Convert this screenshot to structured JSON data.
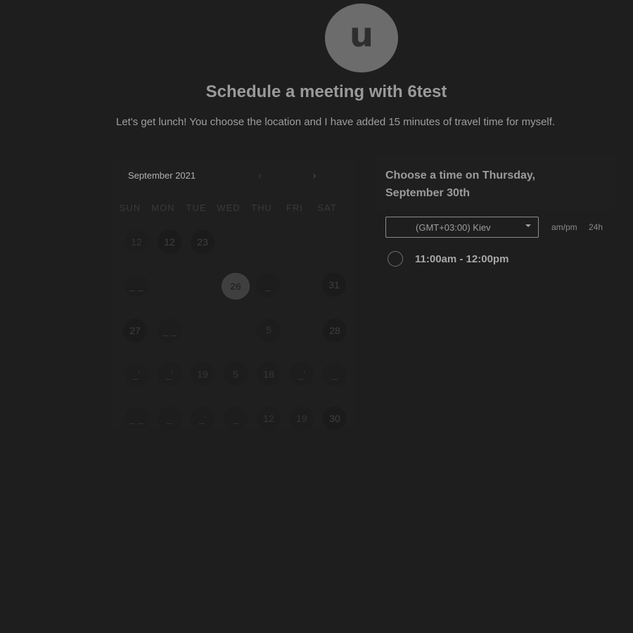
{
  "host": {
    "avatar_initial": "u",
    "title": "Schedule a meeting with 6test",
    "description": "Let's get lunch! You choose the location and I have added 15 minutes of travel time for myself."
  },
  "calendar": {
    "month_label": "September 2021",
    "prev_icon": "‹",
    "next_icon": "›",
    "weekdays": [
      "SUN",
      "MON",
      "TUE",
      "WED",
      "THU",
      "FRI",
      "SAT"
    ],
    "days": [
      {
        "label": "12",
        "state": "faded"
      },
      {
        "label": "12",
        "state": "available"
      },
      {
        "label": "23",
        "state": "available"
      },
      {
        "label": "_ _",
        "state": "faded"
      },
      {
        "label": "26",
        "state": "selected"
      },
      {
        "label": "_",
        "state": "faded"
      },
      {
        "label": "31",
        "state": "available"
      },
      {
        "label": "27",
        "state": "available"
      },
      {
        "label": "_ _",
        "state": "faded"
      },
      {
        "label": "5",
        "state": "faded"
      },
      {
        "label": "28",
        "state": "available"
      },
      {
        "label": "_'",
        "state": "faded"
      },
      {
        "label": "_'",
        "state": "faded"
      },
      {
        "label": "19",
        "state": "faded"
      },
      {
        "label": "5",
        "state": "faded"
      },
      {
        "label": "18",
        "state": "faded"
      },
      {
        "label": "_'",
        "state": "faded"
      },
      {
        "label": "_",
        "state": "faded"
      },
      {
        "label": "_ _",
        "state": "faded"
      },
      {
        "label": "_",
        "state": "faded"
      },
      {
        "label": "_'",
        "state": "faded"
      },
      {
        "label": "_",
        "state": "faded"
      },
      {
        "label": "12",
        "state": "faded"
      },
      {
        "label": "19",
        "state": "faded"
      },
      {
        "label": "30",
        "state": "available"
      }
    ]
  },
  "times": {
    "heading": "Choose a time on Thursday, September 30th",
    "timezone": "(GMT+03:00) Kiev",
    "format_ampm": "am/pm",
    "format_24h": "24h",
    "slots": [
      {
        "label": "11:00am - 12:00pm"
      }
    ]
  }
}
